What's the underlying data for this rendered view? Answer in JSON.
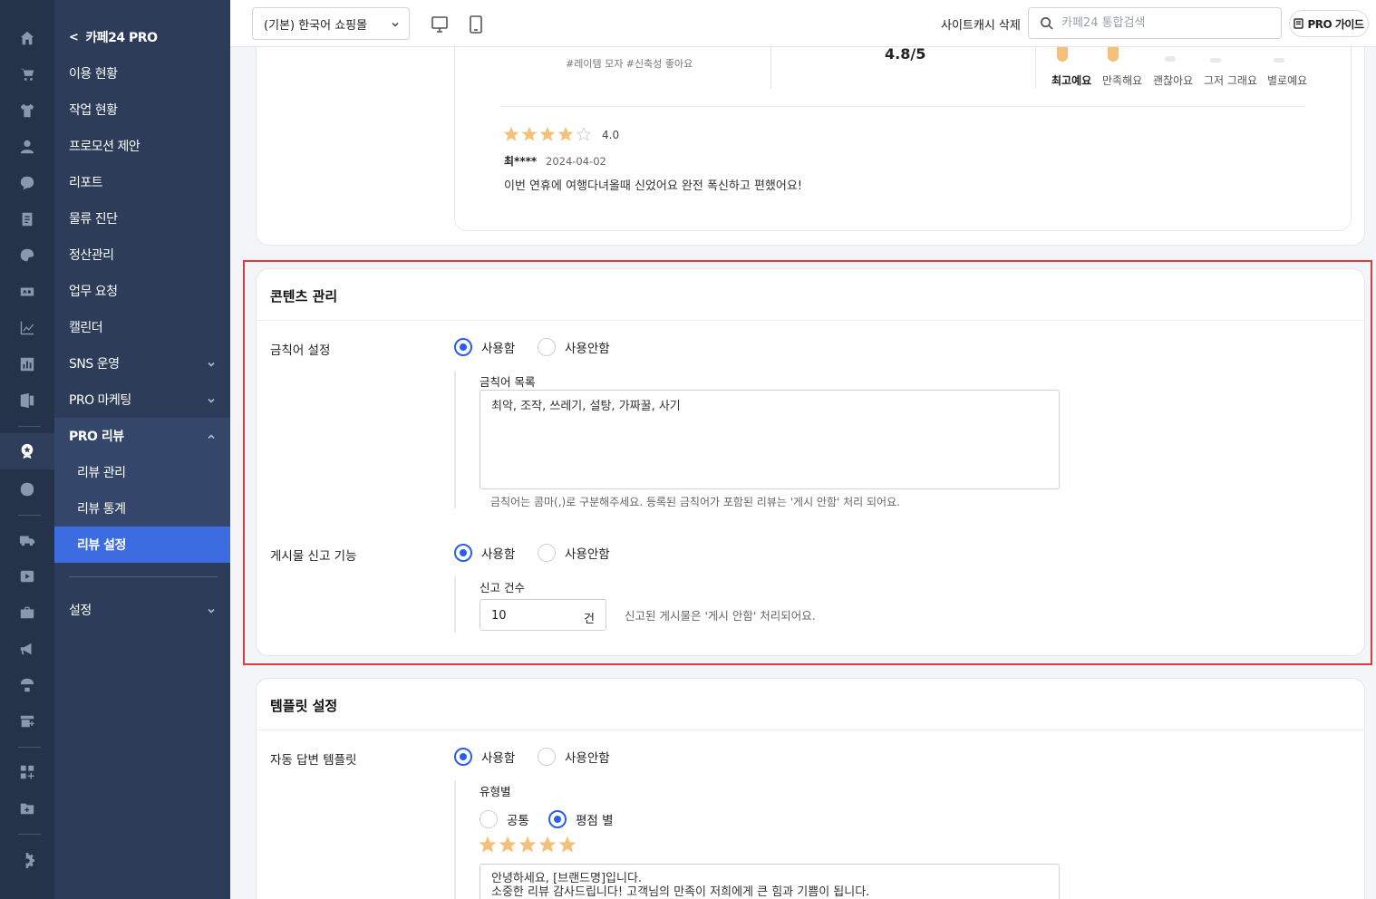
{
  "rail": {
    "icons": [
      "home-icon",
      "cart-icon",
      "shirt-icon",
      "user-icon",
      "chat-icon",
      "board-icon",
      "palette-icon",
      "ad-icon",
      "chart-line-icon",
      "chart-bar-icon",
      "excel-icon",
      "pro-review-icon",
      "promo-icon",
      "truck-icon",
      "youtube-icon",
      "briefcase-icon",
      "megaphone-icon",
      "parachute-icon",
      "store-plus-icon",
      "apps-plus-icon",
      "folder-plus-icon",
      "settings-icon"
    ]
  },
  "nav": {
    "back_label": "카페24 PRO",
    "items": [
      "이용 현황",
      "작업 현황",
      "프로모션 제안",
      "리포트",
      "물류 진단",
      "정산관리",
      "업무 요청",
      "캘린더",
      "SNS 운영",
      "PRO 마케팅"
    ],
    "open_section": "PRO 리뷰",
    "sub_items": [
      "리뷰 관리",
      "리뷰 통계",
      "리뷰 설정"
    ],
    "settings_label": "설정"
  },
  "header": {
    "shop_select": "(기본) 한국어 쇼핑몰",
    "cache_delete": "사이트캐시 삭제",
    "search_placeholder": "카페24 통합검색",
    "pro_guide": "PRO 가이드"
  },
  "review_preview": {
    "tags": "#레이템 모자 #신축성 좋아요",
    "score": "4.8/5",
    "rating_labels": [
      "최고예요",
      "만족해요",
      "괜찮아요",
      "그저 그래요",
      "별로예요"
    ],
    "review_rating": "4.0",
    "review_rating_value": 4,
    "reviewer": "최****",
    "review_date": "2024-04-02",
    "review_text": "이번 연휴에 여행다녀올때 신었어요 완전 폭신하고 편했어요!"
  },
  "content_mgmt": {
    "title": "콘텐츠 관리",
    "banned_words": {
      "label": "금칙어 설정",
      "option_on": "사용함",
      "option_off": "사용안함",
      "list_label": "금칙어 목록",
      "list_value": "최악, 조작, 쓰레기, 설탕, 가짜꿀, 사기",
      "hint": "금칙어는 콤마(,)로 구분해주세요. 등록된 금칙어가 포함된 리뷰는 '게시 안함' 처리 되어요."
    },
    "report": {
      "label": "게시물 신고 기능",
      "option_on": "사용함",
      "option_off": "사용안함",
      "count_label": "신고 건수",
      "count_value": "10",
      "count_unit": "건",
      "hint": "신고된 게시물은 '게시 안함' 처리되어요."
    }
  },
  "template": {
    "title": "템플릿 설정",
    "auto_reply": {
      "label": "자동 답변 템플릿",
      "option_on": "사용함",
      "option_off": "사용안함",
      "type_label": "유형별",
      "type_common": "공통",
      "type_rating": "평점 별",
      "star_count": 5,
      "text_line1": "안녕하세요, [브랜드명]입니다.",
      "text_line2": "소중한 리뷰 감사드립니다! 고객님의 만족이 저희에게 큰 힘과 기쁨이 됩니다."
    }
  },
  "colors": {
    "accent": "#2a5ef1",
    "nav_bg": "#2c3c59",
    "rail_bg": "#24324a",
    "selected": "#3d6be0",
    "star": "#f4c07a",
    "highlight": "#e03a3a"
  }
}
